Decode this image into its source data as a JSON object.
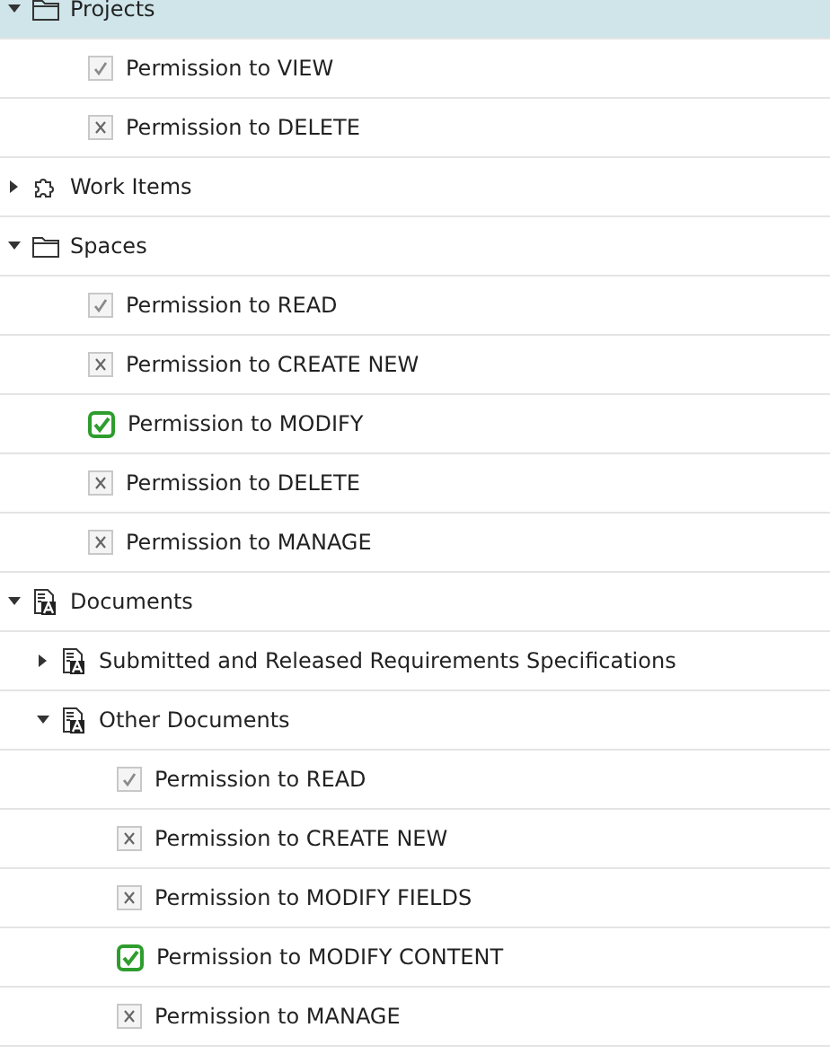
{
  "tree": [
    {
      "kind": "folder",
      "label": "Projects",
      "expanded": true,
      "selected": true,
      "children": [
        {
          "kind": "permission",
          "label": "Permission to VIEW",
          "checked": true,
          "explicit": false,
          "selected": false
        },
        {
          "kind": "permission",
          "label": "Permission to DELETE",
          "checked": false,
          "explicit": false,
          "selected": false
        }
      ]
    },
    {
      "kind": "component",
      "label": "Work Items",
      "expanded": false,
      "selected": false
    },
    {
      "kind": "folder",
      "label": "Spaces",
      "expanded": true,
      "selected": false,
      "children": [
        {
          "kind": "permission",
          "label": "Permission to READ",
          "checked": true,
          "explicit": false,
          "selected": false
        },
        {
          "kind": "permission",
          "label": "Permission to CREATE NEW",
          "checked": false,
          "explicit": false,
          "selected": false
        },
        {
          "kind": "permission",
          "label": "Permission to MODIFY",
          "checked": true,
          "explicit": true,
          "selected": false
        },
        {
          "kind": "permission",
          "label": "Permission to DELETE",
          "checked": false,
          "explicit": false,
          "selected": false
        },
        {
          "kind": "permission",
          "label": "Permission to MANAGE",
          "checked": false,
          "explicit": false,
          "selected": false
        }
      ]
    },
    {
      "kind": "document",
      "label": "Documents",
      "expanded": true,
      "selected": false,
      "children": [
        {
          "kind": "document",
          "label": "Submitted and Released Requirements Specifications",
          "expanded": false,
          "selected": false
        },
        {
          "kind": "document",
          "label": "Other Documents",
          "expanded": true,
          "selected": false,
          "children": [
            {
              "kind": "permission",
              "label": "Permission to READ",
              "checked": true,
              "explicit": false,
              "selected": false
            },
            {
              "kind": "permission",
              "label": "Permission to CREATE NEW",
              "checked": false,
              "explicit": false,
              "selected": false
            },
            {
              "kind": "permission",
              "label": "Permission to MODIFY FIELDS",
              "checked": false,
              "explicit": false,
              "selected": false
            },
            {
              "kind": "permission",
              "label": "Permission to MODIFY CONTENT",
              "checked": true,
              "explicit": true,
              "selected": false
            },
            {
              "kind": "permission",
              "label": "Permission to MANAGE",
              "checked": false,
              "explicit": false,
              "selected": false
            }
          ]
        }
      ]
    }
  ]
}
